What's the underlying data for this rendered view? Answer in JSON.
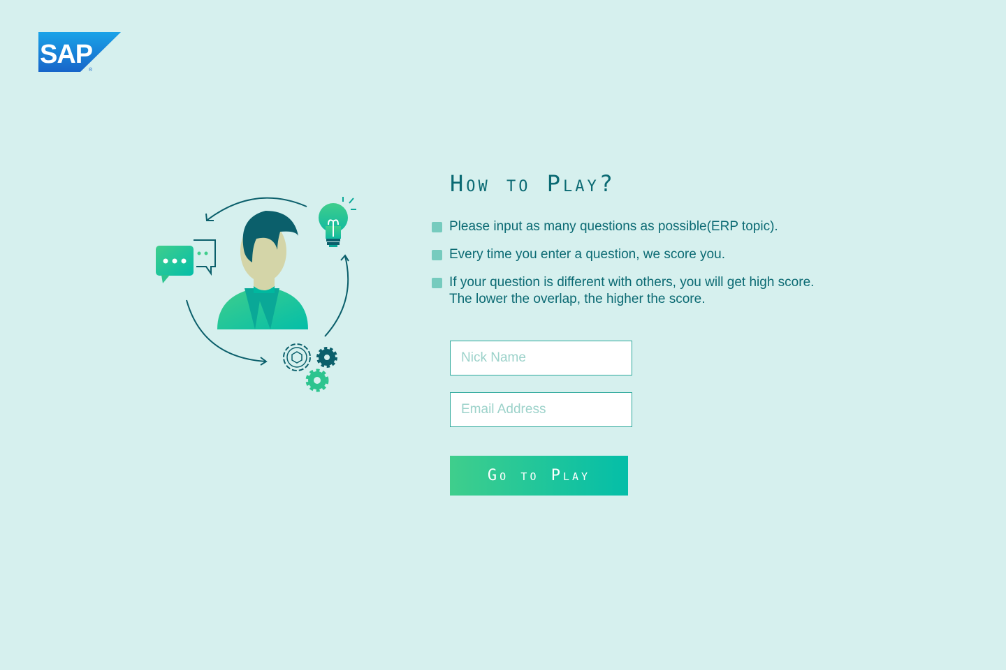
{
  "brand": {
    "logo_text": "SAP",
    "registered_mark": "®"
  },
  "main": {
    "title": "How to Play?",
    "rules": [
      {
        "line1": "Please input as many questions as possible(ERP topic).",
        "line2": ""
      },
      {
        "line1": "Every time you enter a question, we score you.",
        "line2": ""
      },
      {
        "line1": "If your question is different with others, you will get high score.",
        "line2": "The lower the overlap, the higher the score."
      }
    ]
  },
  "form": {
    "nickname": {
      "placeholder": "Nick Name",
      "value": ""
    },
    "email": {
      "placeholder": "Email Address",
      "value": ""
    },
    "submit_label": "Go to Play"
  },
  "icons": {
    "bullet": "square-bullet-icon",
    "illustration": [
      "person-icon",
      "chat-bubbles-icon",
      "lightbulb-icon",
      "gears-icon",
      "cycle-arrows-icon"
    ]
  },
  "colors": {
    "background": "#d6f0ee",
    "text": "#0b6a73",
    "bullet": "#76cbbe",
    "button_start": "#3fce8c",
    "button_end": "#04bea8",
    "logo_blue_top": "#1aa3e8",
    "logo_blue_bottom": "#1765c9"
  }
}
